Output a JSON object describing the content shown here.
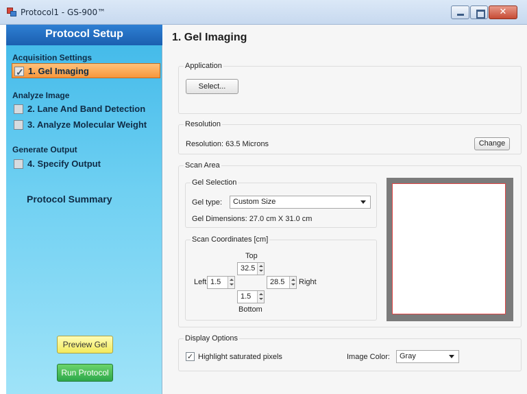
{
  "window": {
    "title": "Protocol1 - GS-900™",
    "close_glyph": "✕"
  },
  "sidebar": {
    "header": "Protocol Setup",
    "sections": [
      {
        "title": "Acquisition Settings",
        "steps": [
          {
            "label": "1. Gel Imaging",
            "checked": true,
            "active": true
          }
        ]
      },
      {
        "title": "Analyze Image",
        "steps": [
          {
            "label": "2. Lane And Band Detection",
            "checked": false
          },
          {
            "label": "3. Analyze Molecular Weight",
            "checked": false
          }
        ]
      },
      {
        "title": "Generate Output",
        "steps": [
          {
            "label": "4. Specify Output",
            "checked": false
          }
        ]
      }
    ],
    "summary": "Protocol Summary",
    "preview_button": "Preview Gel",
    "run_button": "Run Protocol"
  },
  "main": {
    "title": "1. Gel Imaging",
    "application": {
      "label": "Application",
      "select_button": "Select..."
    },
    "resolution": {
      "label": "Resolution",
      "text": "Resolution:  63.5  Microns",
      "change_button": "Change"
    },
    "scan_area": {
      "label": "Scan Area",
      "gel_selection": {
        "label": "Gel Selection",
        "gel_type_label": "Gel type:",
        "gel_type_value": "Custom Size",
        "dimensions": "Gel Dimensions:  27.0 cm X 31.0 cm"
      },
      "coordinates": {
        "label": "Scan Coordinates [cm]",
        "top_label": "Top",
        "top_value": "32.5",
        "left_label": "Left",
        "left_value": "1.5",
        "right_value": "28.5",
        "right_label": "Right",
        "bottom_value": "1.5",
        "bottom_label": "Bottom"
      }
    },
    "display_options": {
      "label": "Display Options",
      "highlight_label": "Highlight saturated pixels",
      "highlight_checked": true,
      "image_color_label": "Image Color:",
      "image_color_value": "Gray"
    }
  },
  "colors": {
    "sidebar_header": "#1b5fb0",
    "active_step": "#f7963b",
    "preview_button": "#f2ea5c",
    "run_button": "#2ea84a",
    "preview_border": "#e04545"
  }
}
